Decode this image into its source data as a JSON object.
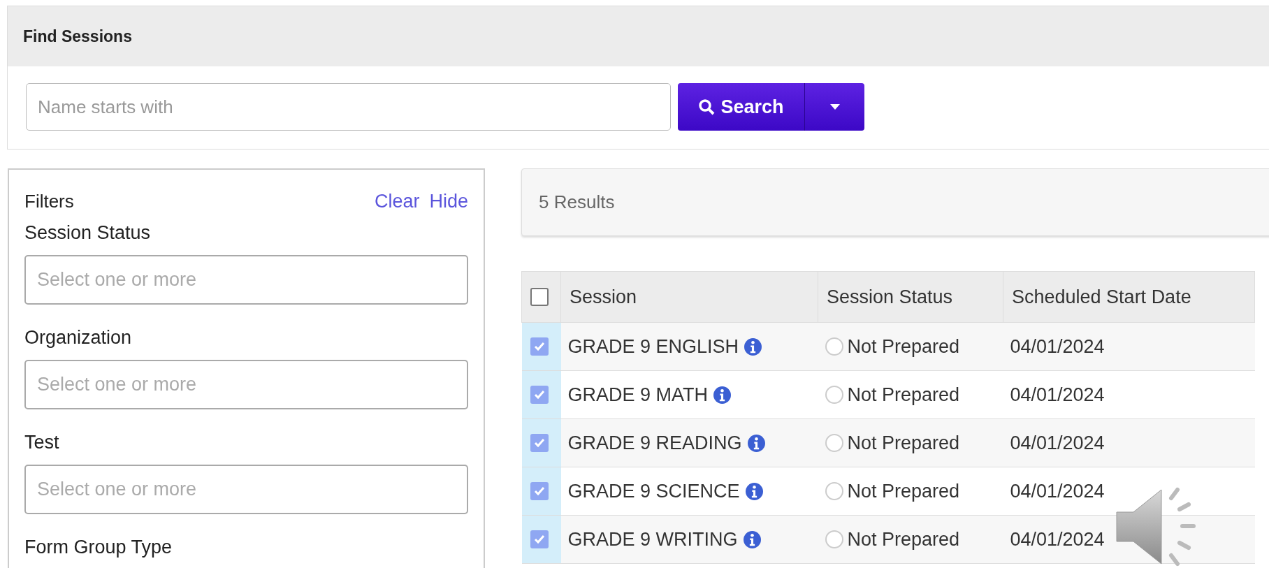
{
  "header": {
    "title": "Find Sessions"
  },
  "search": {
    "placeholder": "Name starts with",
    "button": "Search"
  },
  "filters": {
    "title": "Filters",
    "links": [
      "Clear",
      "Hide"
    ],
    "fields": [
      {
        "label": "Session Status",
        "placeholder": "Select one or more"
      },
      {
        "label": "Organization",
        "placeholder": "Select one or more"
      },
      {
        "label": "Test",
        "placeholder": "Select one or more"
      },
      {
        "label": "Form Group Type"
      }
    ]
  },
  "results": {
    "count": "5 Results"
  },
  "table": {
    "all_checked": false,
    "columns": [
      "Session",
      "Session Status",
      "Scheduled Start Date"
    ],
    "rows": [
      {
        "checked": true,
        "session": "GRADE 9 ENGLISH",
        "prepared": false,
        "status": "Not Prepared",
        "date": "04/01/2024"
      },
      {
        "checked": true,
        "session": "GRADE 9 MATH",
        "prepared": false,
        "status": "Not Prepared",
        "date": "04/01/2024"
      },
      {
        "checked": true,
        "session": "GRADE 9 READING",
        "prepared": false,
        "status": "Not Prepared",
        "date": "04/01/2024"
      },
      {
        "checked": true,
        "session": "GRADE 9 SCIENCE",
        "prepared": false,
        "status": "Not Prepared",
        "date": "04/01/2024"
      },
      {
        "checked": true,
        "session": "GRADE 9 WRITING",
        "prepared": false,
        "status": "Not Prepared",
        "date": "04/01/2024"
      }
    ]
  }
}
